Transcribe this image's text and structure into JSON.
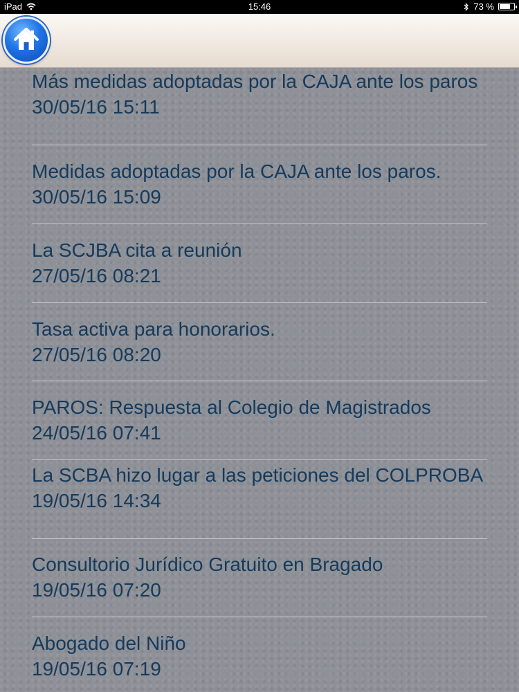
{
  "status_bar": {
    "device": "iPad",
    "time": "15:46",
    "battery": "73 %",
    "battery_level": 0.73
  },
  "header": {
    "home_icon": "home-icon",
    "colors": {
      "header_bg": "#f0e9e1",
      "home_blue": "#1f74e6"
    }
  },
  "news": [
    {
      "title": "Más medidas adoptadas por la CAJA ante los paros",
      "date": "30/05/16 15:11"
    },
    {
      "title": "Medidas adoptadas por la CAJA ante los paros.",
      "date": "30/05/16 15:09"
    },
    {
      "title": "La SCJBA cita a reunión",
      "date": "27/05/16 08:21"
    },
    {
      "title": "Tasa activa para honorarios.",
      "date": "27/05/16 08:20"
    },
    {
      "title": "PAROS: Respuesta al Colegio de Magistrados",
      "date": "24/05/16 07:41"
    },
    {
      "title": "La SCBA hizo lugar a las peticiones del COLPROBA",
      "date": "19/05/16 14:34"
    },
    {
      "title": "Consultorio Jurídico Gratuito en Bragado",
      "date": "19/05/16 07:20"
    },
    {
      "title": "Abogado del Niño",
      "date": "19/05/16 07:19"
    }
  ],
  "colors": {
    "text": "#153a5c",
    "list_bg": "#8e9197",
    "divider": "#c9cbcf"
  }
}
